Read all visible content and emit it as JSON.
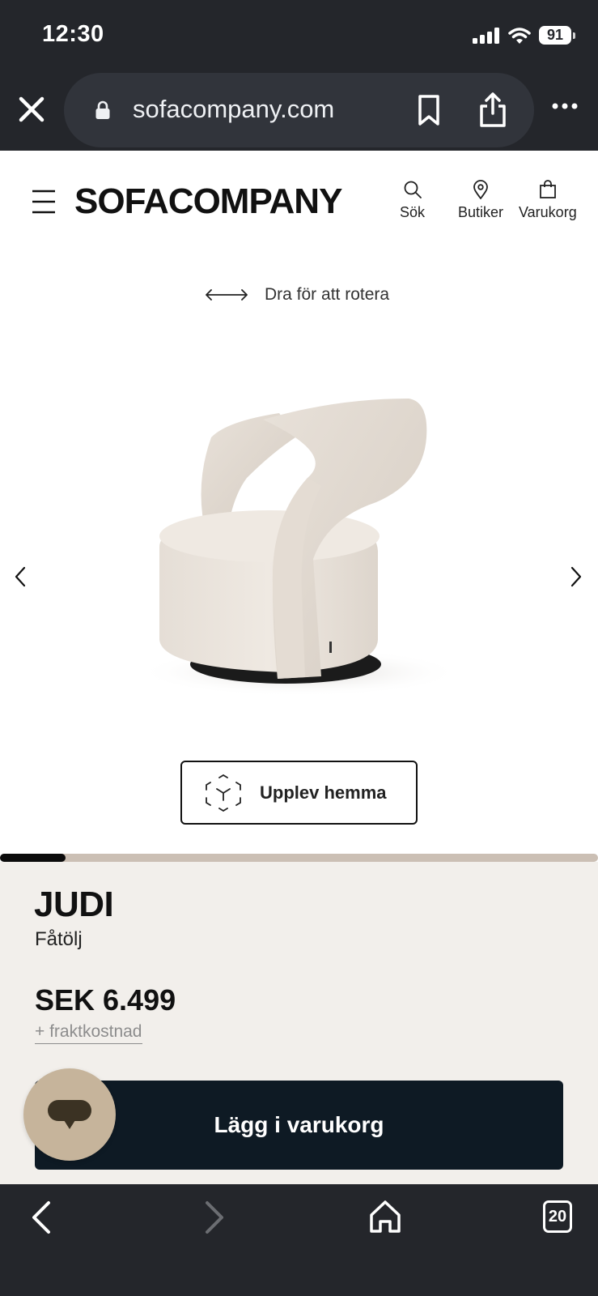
{
  "status_bar": {
    "time": "12:30",
    "battery": "91",
    "icons": [
      "signal-icon",
      "wifi-icon",
      "battery-icon"
    ]
  },
  "browser": {
    "url": "sofacompany.com",
    "icons": [
      "close-icon",
      "lock-icon",
      "bookmark-icon",
      "share-icon",
      "more-icon"
    ]
  },
  "header": {
    "logo": "SOFACOMPANY",
    "nav": [
      {
        "label": "Sök",
        "icon": "search-icon"
      },
      {
        "label": "Butiker",
        "icon": "location-pin-icon"
      },
      {
        "label": "Varukorg",
        "icon": "shopping-bag-icon"
      }
    ]
  },
  "viewer": {
    "rotate_hint": "Dra för att rotera",
    "ar_button": "Upplev hemma",
    "progress": 0.11
  },
  "product": {
    "name": "JUDI",
    "type": "Fåtölj",
    "price": "SEK 6.499",
    "shipping": "+ fraktkostnad",
    "add_to_cart": "Lägg i varukorg"
  },
  "bottom_bar": {
    "tabs_count": "20"
  },
  "colors": {
    "browser_chrome": "#24262b",
    "info_panel_bg": "#f2efeb",
    "cart_button_bg": "#0e1a24",
    "chat_button_bg": "#c6b49b",
    "progress_track": "#cbbfb4"
  }
}
